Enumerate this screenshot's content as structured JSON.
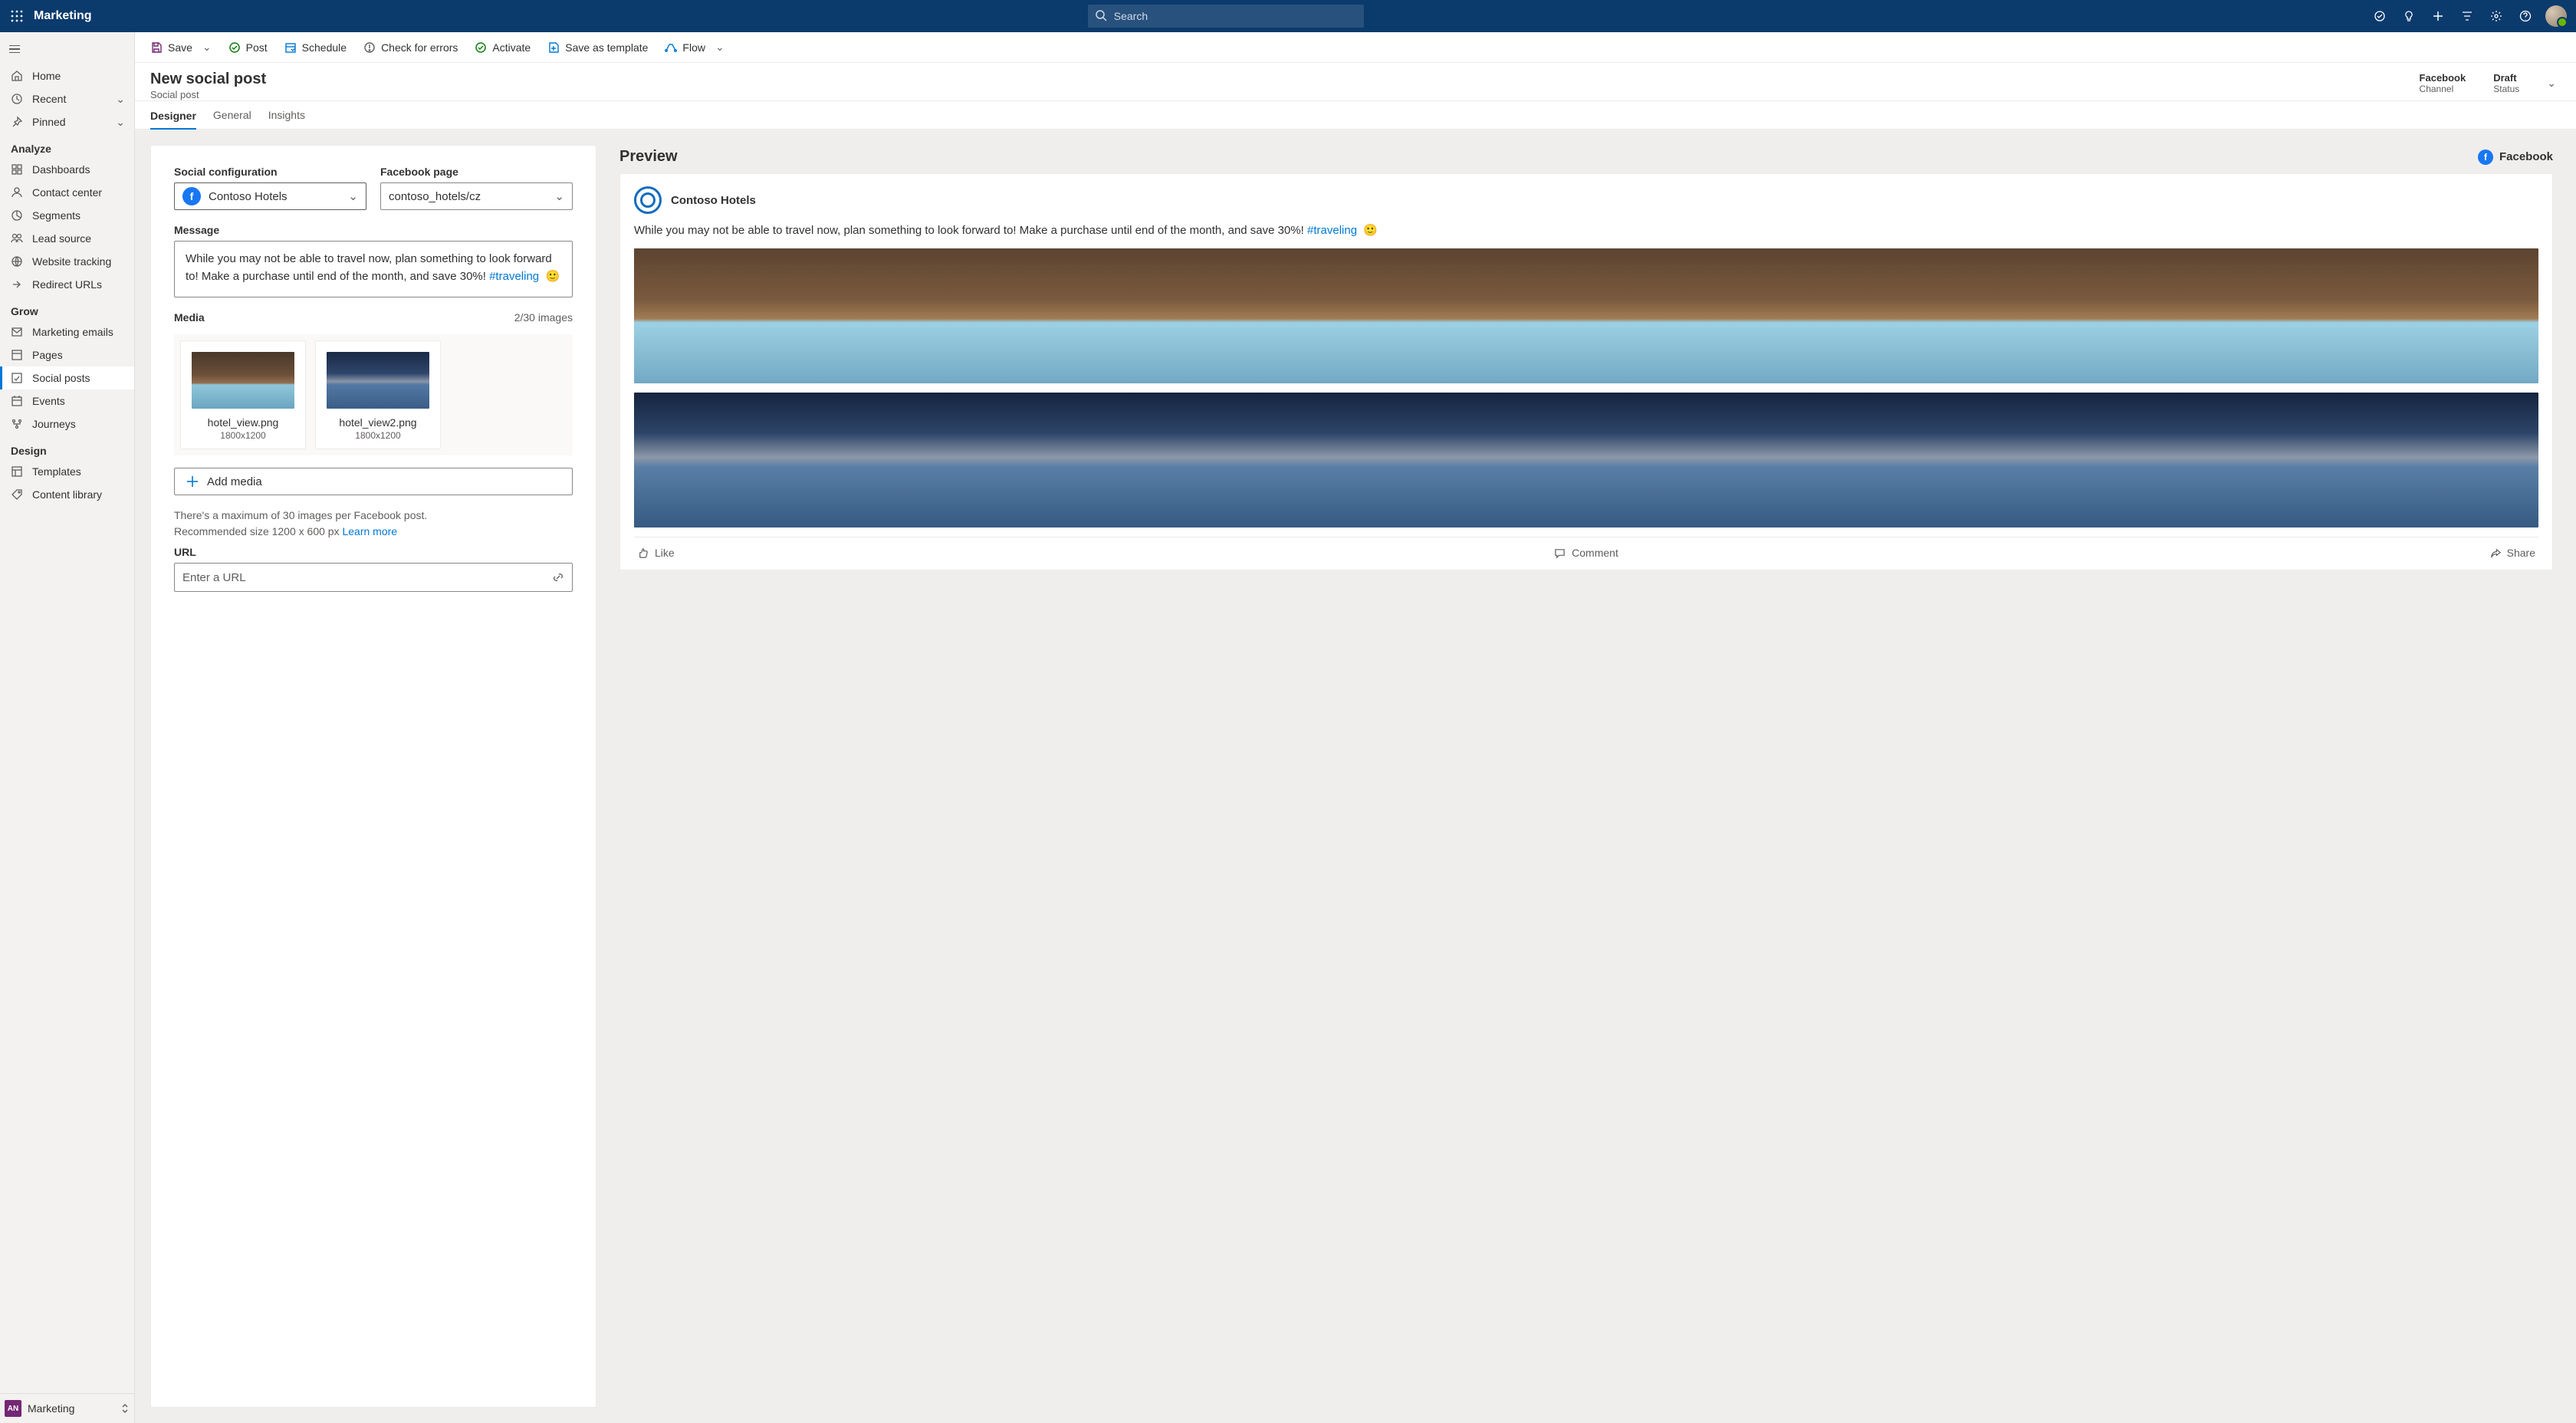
{
  "topbar": {
    "app_title": "Marketing",
    "search_placeholder": "Search"
  },
  "sidebar": {
    "top": [
      {
        "label": "Home",
        "icon": "home"
      },
      {
        "label": "Recent",
        "icon": "clock",
        "chevron": true
      },
      {
        "label": "Pinned",
        "icon": "pin",
        "chevron": true
      }
    ],
    "sections": [
      {
        "title": "Analyze",
        "items": [
          {
            "label": "Dashboards",
            "icon": "dashboard"
          },
          {
            "label": "Contact center",
            "icon": "person"
          },
          {
            "label": "Segments",
            "icon": "segments"
          },
          {
            "label": "Lead source",
            "icon": "people"
          },
          {
            "label": "Website tracking",
            "icon": "globe"
          },
          {
            "label": "Redirect URLs",
            "icon": "redirect"
          }
        ]
      },
      {
        "title": "Grow",
        "items": [
          {
            "label": "Marketing emails",
            "icon": "mail"
          },
          {
            "label": "Pages",
            "icon": "page"
          },
          {
            "label": "Social posts",
            "icon": "social",
            "selected": true
          },
          {
            "label": "Events",
            "icon": "calendar"
          },
          {
            "label": "Journeys",
            "icon": "journey"
          }
        ]
      },
      {
        "title": "Design",
        "items": [
          {
            "label": "Templates",
            "icon": "template"
          },
          {
            "label": "Content library",
            "icon": "tag"
          }
        ]
      }
    ],
    "footer": {
      "badge": "AN",
      "label": "Marketing"
    }
  },
  "commandbar": [
    {
      "label": "Save",
      "icon": "save",
      "split": true,
      "color": "#742774"
    },
    {
      "label": "Post",
      "icon": "check-circle",
      "color": "#107c10"
    },
    {
      "label": "Schedule",
      "icon": "schedule",
      "color": "#0078d4"
    },
    {
      "label": "Check for errors",
      "icon": "error",
      "color": "#605e5c"
    },
    {
      "label": "Activate",
      "icon": "check-circle",
      "color": "#107c10"
    },
    {
      "label": "Save as template",
      "icon": "save-template",
      "color": "#0078d4"
    },
    {
      "label": "Flow",
      "icon": "flow",
      "chevron": true,
      "color": "#0078d4"
    }
  ],
  "header": {
    "title": "New social post",
    "subtitle": "Social post",
    "meta": [
      {
        "value": "Facebook",
        "label": "Channel"
      },
      {
        "value": "Draft",
        "label": "Status"
      }
    ],
    "tabs": [
      "Designer",
      "General",
      "Insights"
    ],
    "active_tab": "Designer"
  },
  "form": {
    "social_config_label": "Social configuration",
    "social_config_value": "Contoso Hotels",
    "fb_page_label": "Facebook page",
    "fb_page_value": "contoso_hotels/cz",
    "message_label": "Message",
    "message_text": "While you may not be able to travel now, plan something to look forward to! Make a purchase until end of the month, and save 30%!",
    "message_hashtag": "#traveling",
    "message_emoji": "🙂",
    "media_label": "Media",
    "media_count": "2/30 images",
    "media": [
      {
        "name": "hotel_view.png",
        "dim": "1800x1200"
      },
      {
        "name": "hotel_view2.png",
        "dim": "1800x1200"
      }
    ],
    "add_media": "Add media",
    "media_note1": "There's a maximum of 30 images per Facebook post.",
    "media_note2": "Recommended size 1200 x 600 px ",
    "learn_more": "Learn more",
    "url_label": "URL",
    "url_placeholder": "Enter a URL"
  },
  "preview": {
    "title": "Preview",
    "channel": "Facebook",
    "account": "Contoso Hotels",
    "text": "While you may not be able to travel now, plan something to look forward to! Make a purchase until end of the month, and save 30%!",
    "hashtag": "#traveling",
    "emoji": "🙂",
    "actions": [
      "Like",
      "Comment",
      "Share"
    ]
  }
}
